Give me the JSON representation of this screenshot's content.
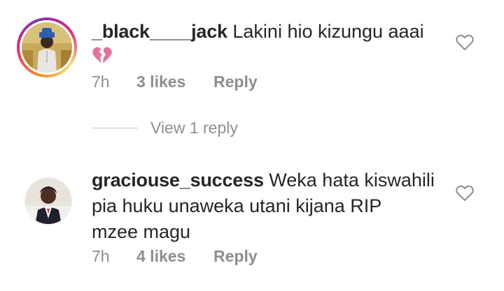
{
  "comments": [
    {
      "username": "_black____jack",
      "text": "Lakini hio kizungu aaai",
      "emoji_icon": "broken-heart-icon",
      "time": "7h",
      "likes": "3 likes",
      "reply_label": "Reply"
    },
    {
      "username": "graciouse_success",
      "text_line1": "Weka hata kiswahili",
      "text_line2": "pia huku unaweka utani kijana RIP",
      "text_line3": "mzee magu",
      "time": "7h",
      "likes": "4 likes",
      "reply_label": "Reply"
    }
  ],
  "view_replies_label": "View 1 reply",
  "colors": {
    "text": "#262626",
    "secondary": "#8e8e8e",
    "emoji": "#e57399"
  }
}
